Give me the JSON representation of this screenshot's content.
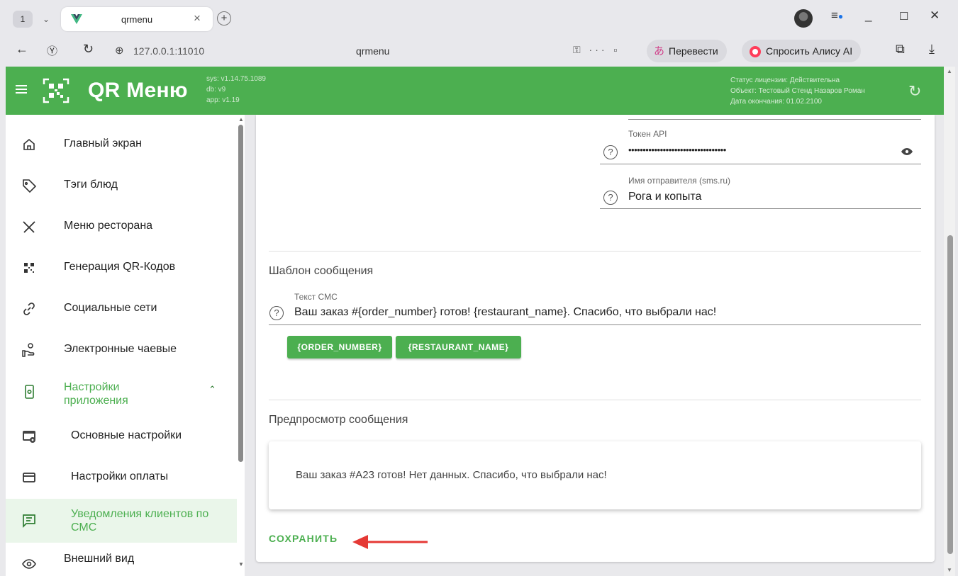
{
  "browser": {
    "tab_count": "1",
    "tab_title": "qrmenu",
    "url": "127.0.0.1:11010",
    "page_title": "qrmenu",
    "translate_label": "Перевести",
    "alice_label": "Спросить Алису AI"
  },
  "header": {
    "title": "QR Меню",
    "version": [
      "sys: v1.14.75.1089",
      "db: v9",
      "app: v1.19"
    ],
    "license": [
      "Статус лицензии: Действительна",
      "Объект: Тестовый Стенд Назаров Роман",
      "Дата окончания: 01.02.2100"
    ]
  },
  "sidebar": {
    "items": [
      {
        "label": "Главный экран",
        "icon": "home-icon"
      },
      {
        "label": "Тэги блюд",
        "icon": "tag-icon"
      },
      {
        "label": "Меню ресторана",
        "icon": "utensils-icon"
      },
      {
        "label": "Генерация QR-Кодов",
        "icon": "qr-icon"
      },
      {
        "label": "Социальные сети",
        "icon": "link-icon"
      },
      {
        "label": "Электронные чаевые",
        "icon": "tips-icon"
      },
      {
        "label": "Настройки приложения",
        "icon": "settings-app-icon"
      },
      {
        "label": "Основные настройки",
        "icon": "web-settings-icon"
      },
      {
        "label": "Настройки оплаты",
        "icon": "card-icon"
      },
      {
        "label": "Уведомления клиентов по СМС",
        "icon": "message-icon"
      },
      {
        "label": "Внешний вид",
        "icon": "eye-icon"
      }
    ]
  },
  "form": {
    "token_label": "Токен API",
    "token_value": "••••••••••••••••••••••••••••••••••",
    "sender_label": "Имя отправителя (sms.ru)",
    "sender_value": "Рога и копыта",
    "template_title": "Шаблон сообщения",
    "sms_label": "Текст СМС",
    "sms_value": "Ваш заказ #{order_number} готов! {restaurant_name}. Спасибо, что выбрали нас!",
    "chips": [
      "{ORDER_NUMBER}",
      "{RESTAURANT_NAME}"
    ],
    "preview_title": "Предпросмотр сообщения",
    "preview_text": "Ваш заказ #A23 готов! Нет данных. Спасибо, что выбрали нас!",
    "save_label": "СОХРАНИТЬ"
  },
  "colors": {
    "brand": "#4caf50",
    "annotation_arrow": "#e53935"
  }
}
